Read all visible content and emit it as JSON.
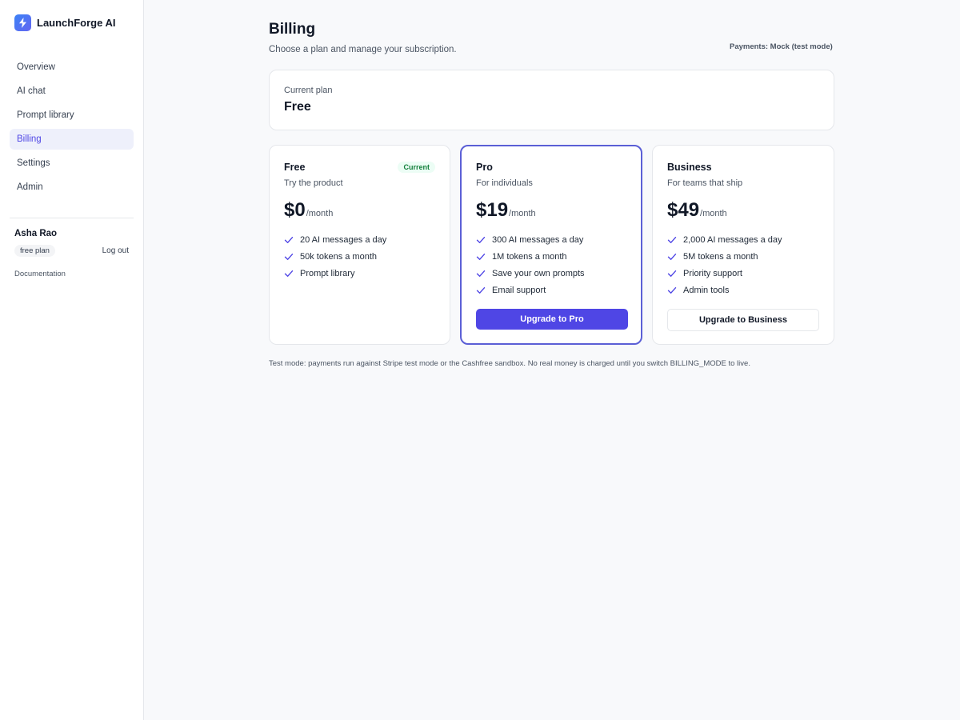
{
  "app": {
    "name": "LaunchForge AI"
  },
  "sidebar": {
    "items": [
      {
        "label": "Overview",
        "active": false
      },
      {
        "label": "AI chat",
        "active": false
      },
      {
        "label": "Prompt library",
        "active": false
      },
      {
        "label": "Billing",
        "active": true
      },
      {
        "label": "Settings",
        "active": false
      },
      {
        "label": "Admin",
        "active": false
      }
    ],
    "user": {
      "name": "Asha Rao",
      "plan_badge": "free plan",
      "logout_label": "Log out"
    },
    "docs_label": "Documentation"
  },
  "header": {
    "title": "Billing",
    "subtitle": "Choose a plan and manage your subscription.",
    "payments_mode": "Payments: Mock (test mode)"
  },
  "current_plan": {
    "label": "Current plan",
    "value": "Free"
  },
  "plans": [
    {
      "name": "Free",
      "tagline": "Try the product",
      "price": "$0",
      "unit": "/month",
      "badge": "Current",
      "features": [
        "20 AI messages a day",
        "50k tokens a month",
        "Prompt library"
      ]
    },
    {
      "name": "Pro",
      "tagline": "For individuals",
      "price": "$19",
      "unit": "/month",
      "features": [
        "300 AI messages a day",
        "1M tokens a month",
        "Save your own prompts",
        "Email support"
      ],
      "button_label": "Upgrade to Pro"
    },
    {
      "name": "Business",
      "tagline": "For teams that ship",
      "price": "$49",
      "unit": "/month",
      "features": [
        "2,000 AI messages a day",
        "5M tokens a month",
        "Priority support",
        "Admin tools"
      ],
      "button_label": "Upgrade to Business"
    }
  ],
  "footnote": "Test mode: payments run against Stripe test mode or the Cashfree sandbox. No real money is charged until you switch BILLING_MODE to live.",
  "colors": {
    "accent": "#4f46e5",
    "current_badge": "#15803d",
    "check": "#4f46e5"
  },
  "icons": {
    "brand": "lightning-bolt-icon",
    "feature": "check-icon"
  }
}
